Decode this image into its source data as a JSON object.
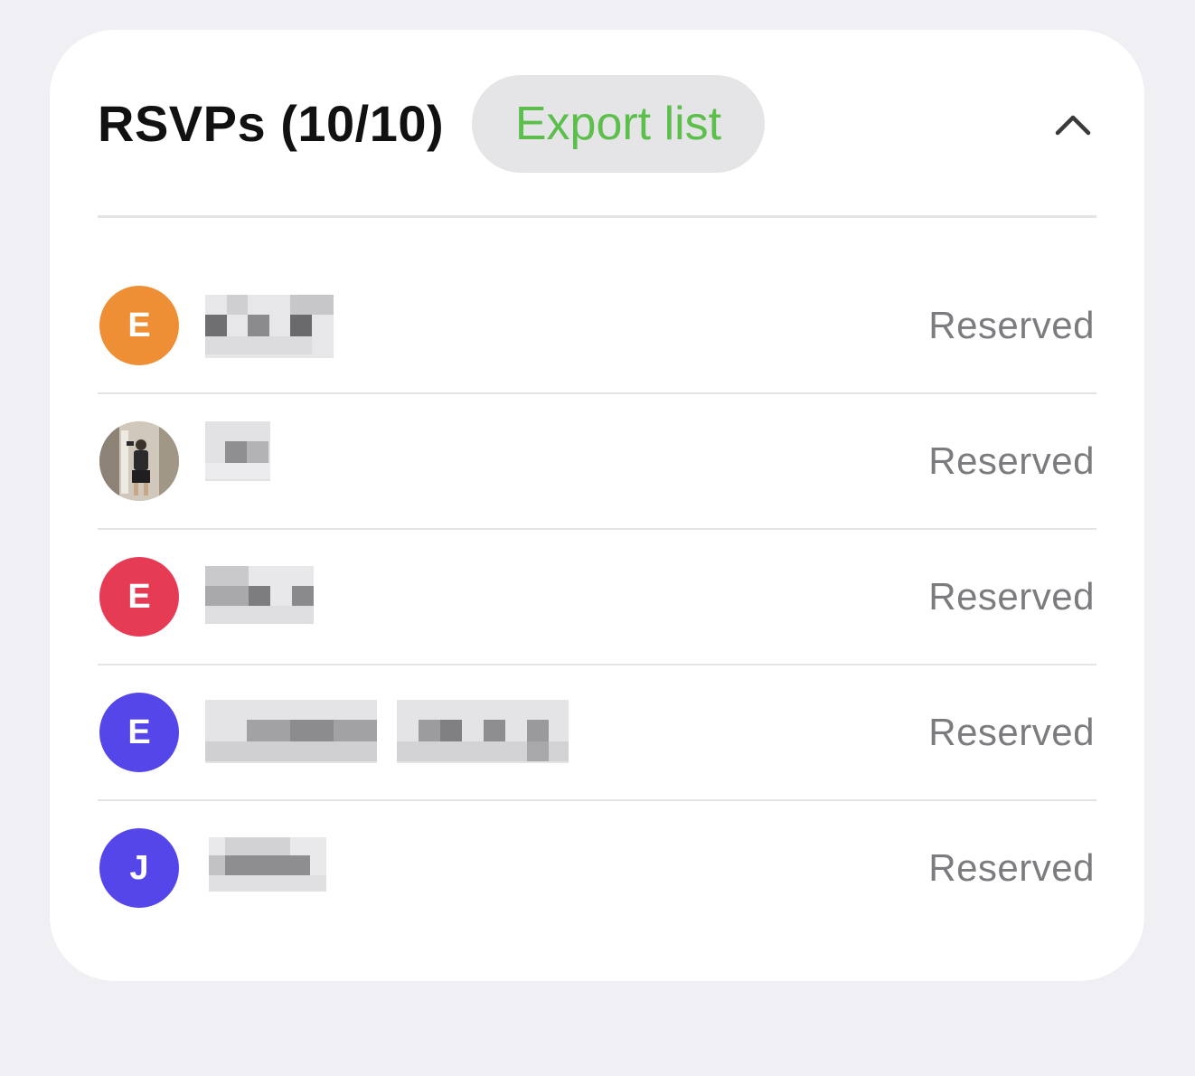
{
  "rsvp_panel": {
    "title": "RSVPs (10/10)",
    "export_label": "Export list",
    "collapse_icon": "chevron-up-icon",
    "attendees": [
      {
        "initial": "E",
        "avatar_color": "#ef8f35",
        "status": "Reserved"
      },
      {
        "initial": "",
        "avatar_type": "photo",
        "status": "Reserved"
      },
      {
        "initial": "E",
        "avatar_color": "#e63b55",
        "status": "Reserved"
      },
      {
        "initial": "E",
        "avatar_color": "#5446e8",
        "status": "Reserved"
      },
      {
        "initial": "J",
        "avatar_color": "#5446e8",
        "status": "Reserved"
      }
    ]
  },
  "colors": {
    "accent_green": "#5cbf4c",
    "status_gray": "#7c7c80",
    "background": "#efeff4"
  }
}
